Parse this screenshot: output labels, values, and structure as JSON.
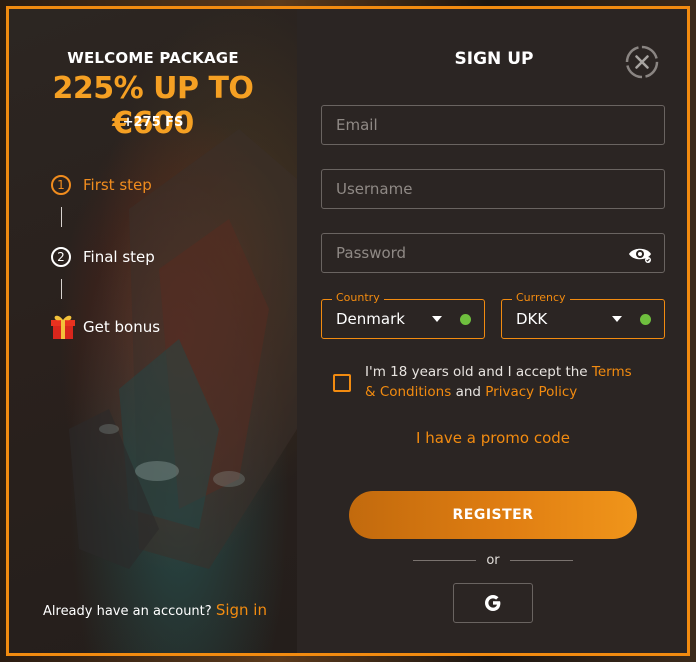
{
  "promo": {
    "title": "WELCOME PACKAGE",
    "offer": "225% UP TO €600",
    "free_spins": "+275 FS",
    "steps": [
      {
        "number": "1",
        "label": "First step",
        "state": "active"
      },
      {
        "number": "2",
        "label": "Final step",
        "state": "pending"
      },
      {
        "icon": "gift-icon",
        "label": "Get bonus"
      }
    ],
    "signin_prompt": "Already have an account?",
    "signin_link": "Sign in"
  },
  "form": {
    "title": "SIGN UP",
    "email_placeholder": "Email",
    "username_placeholder": "Username",
    "password_placeholder": "Password",
    "country": {
      "label": "Country",
      "value": "Denmark"
    },
    "currency": {
      "label": "Currency",
      "value": "DKK"
    },
    "terms_prefix": "I'm 18 years old and I accept the",
    "terms_link": "Terms & Conditions",
    "terms_and": "and",
    "privacy_link": "Privacy Policy",
    "promo_code": "I have a promo code",
    "register_label": "REGISTER",
    "or_label": "or",
    "google_label": "G"
  },
  "colors": {
    "accent": "#f28b10",
    "offer": "#f5a023",
    "valid": "#6fbf3e",
    "panel": "#2b2523"
  }
}
